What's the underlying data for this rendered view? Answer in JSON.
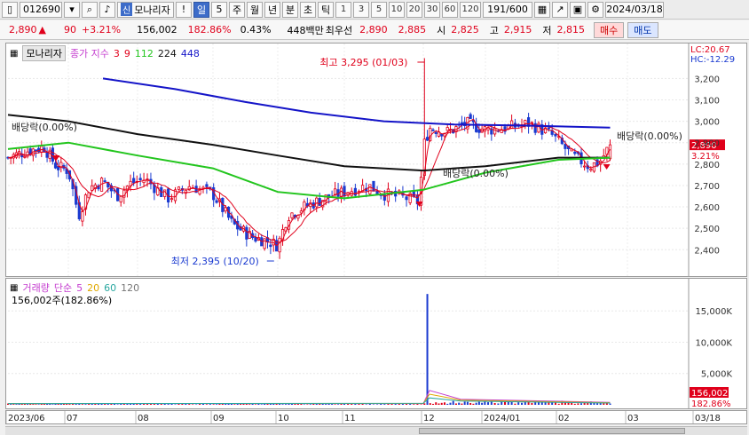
{
  "toolbar": {
    "code": "012690",
    "badge": "신",
    "name": "모나리자",
    "bang": "!",
    "period_day": "일",
    "period_n": "5",
    "period_week": "주",
    "period_month": "월",
    "period_year": "년",
    "period_min": "분",
    "period_sec": "초",
    "period_tick": "틱",
    "intervals": [
      "1",
      "3",
      "5",
      "10",
      "20",
      "30",
      "60",
      "120"
    ],
    "count": "191/600",
    "date": "2024/03/18"
  },
  "quote": {
    "price": "2,890",
    "arrow": "▲",
    "change": "90",
    "change_pct": "+3.21%",
    "volume": "156,002",
    "volume_pct": "182.86%",
    "turnover_pct": "0.43%",
    "amount": "448백만",
    "best_label": "최우선",
    "best_ask": "2,890",
    "best_bid": "2,885",
    "open_label": "시",
    "open": "2,825",
    "high_label": "고",
    "high": "2,915",
    "low_label": "저",
    "low": "2,815",
    "buy": "매수",
    "sell": "매도"
  },
  "colors": {
    "up": "#e0001b",
    "down": "#1a3ad0",
    "ma3": "#e0001b",
    "ma9": "#e0001b",
    "ma112": "#22c51d",
    "ma224": "#111111",
    "ma448": "#1414c8",
    "vol5": "#c43ccf",
    "vol20": "#e0a800",
    "vol60": "#2aa8a0",
    "vol120": "#777777"
  },
  "price_panel": {
    "title": "모나리자",
    "legend_prefix": "종가 지수",
    "ma_periods": [
      "3",
      "9",
      "112",
      "224",
      "448"
    ],
    "lc": "LC:20.67",
    "hc": "HC:-12.29",
    "current_tag": "2,890",
    "current_pct": "3.21%",
    "high_annot": "최고 3,295 (01/03)",
    "low_annot": "최저 2,395 (10/20)",
    "div_annot_1": "배당락(0.00%)",
    "div_annot_2": "배당락(0.00%)",
    "div_annot_3": "배당락(0.00%)"
  },
  "volume_panel": {
    "title": "거래량",
    "legend_prefix": "단순",
    "ma_periods": [
      "5",
      "20",
      "60",
      "120"
    ],
    "current_text": "156,002주(182.86%)",
    "current_tag": "156,002",
    "current_pct": "182.86%"
  },
  "x_axis": {
    "labels": [
      "2023/06",
      "07",
      "08",
      "09",
      "10",
      "11",
      "12",
      "2024/01",
      "02",
      "03",
      "03/18"
    ]
  },
  "chart_data": [
    {
      "type": "candlestick",
      "title": "모나리자",
      "y_ticks": [
        2400,
        2500,
        2600,
        2700,
        2800,
        2900,
        3000,
        3100,
        3200
      ],
      "ylim": [
        2310,
        3330
      ],
      "x_months": [
        "2023/06",
        "07",
        "08",
        "09",
        "10",
        "11",
        "12",
        "2024/01",
        "02",
        "03"
      ],
      "highest": {
        "value": 3295,
        "date": "01/03"
      },
      "lowest": {
        "value": 2395,
        "date": "10/20"
      },
      "last": {
        "open": 2825,
        "high": 2915,
        "low": 2815,
        "close": 2890
      },
      "close_path_anchors": [
        {
          "m": 0.0,
          "close": 2830
        },
        {
          "m": 0.3,
          "close": 2860
        },
        {
          "m": 0.6,
          "close": 2880
        },
        {
          "m": 0.8,
          "close": 2790
        },
        {
          "m": 1.0,
          "close": 2770
        },
        {
          "m": 1.15,
          "close": 2560
        },
        {
          "m": 1.3,
          "close": 2690
        },
        {
          "m": 1.5,
          "close": 2720
        },
        {
          "m": 1.7,
          "close": 2650
        },
        {
          "m": 1.9,
          "close": 2710
        },
        {
          "m": 2.1,
          "close": 2730
        },
        {
          "m": 2.4,
          "close": 2640
        },
        {
          "m": 2.7,
          "close": 2700
        },
        {
          "m": 3.0,
          "close": 2660
        },
        {
          "m": 3.3,
          "close": 2520
        },
        {
          "m": 3.6,
          "close": 2460
        },
        {
          "m": 3.85,
          "close": 2440
        },
        {
          "m": 4.0,
          "close": 2420
        },
        {
          "m": 4.15,
          "close": 2560
        },
        {
          "m": 4.4,
          "close": 2600
        },
        {
          "m": 4.7,
          "close": 2640
        },
        {
          "m": 5.0,
          "close": 2670
        },
        {
          "m": 5.3,
          "close": 2700
        },
        {
          "m": 5.5,
          "close": 2660
        },
        {
          "m": 5.8,
          "close": 2640
        },
        {
          "m": 5.95,
          "close": 2620
        },
        {
          "m": 6.0,
          "close": 2880
        },
        {
          "m": 6.1,
          "close": 2970
        },
        {
          "m": 6.4,
          "close": 2950
        },
        {
          "m": 6.7,
          "close": 2990
        },
        {
          "m": 7.0,
          "close": 2960
        },
        {
          "m": 7.3,
          "close": 2970
        },
        {
          "m": 7.6,
          "close": 2990
        },
        {
          "m": 7.9,
          "close": 2940
        },
        {
          "m": 8.2,
          "close": 2840
        },
        {
          "m": 8.45,
          "close": 2790
        },
        {
          "m": 8.6,
          "close": 2810
        },
        {
          "m": 8.75,
          "close": 2890
        }
      ],
      "ma_series": [
        {
          "name": "224",
          "points": [
            {
              "m": 0,
              "v": 3030
            },
            {
              "m": 1,
              "v": 3000
            },
            {
              "m": 2,
              "v": 2940
            },
            {
              "m": 3,
              "v": 2890
            },
            {
              "m": 4,
              "v": 2840
            },
            {
              "m": 5,
              "v": 2790
            },
            {
              "m": 6,
              "v": 2770
            },
            {
              "m": 7,
              "v": 2790
            },
            {
              "m": 8,
              "v": 2830
            },
            {
              "m": 8.75,
              "v": 2830
            }
          ]
        },
        {
          "name": "112",
          "points": [
            {
              "m": 0,
              "v": 2870
            },
            {
              "m": 1,
              "v": 2900
            },
            {
              "m": 2,
              "v": 2840
            },
            {
              "m": 3,
              "v": 2780
            },
            {
              "m": 4,
              "v": 2670
            },
            {
              "m": 5,
              "v": 2640
            },
            {
              "m": 6,
              "v": 2680
            },
            {
              "m": 7,
              "v": 2760
            },
            {
              "m": 8,
              "v": 2820
            },
            {
              "m": 8.75,
              "v": 2830
            }
          ]
        },
        {
          "name": "448",
          "points": [
            {
              "m": 1.5,
              "v": 3200
            },
            {
              "m": 2.5,
              "v": 3150
            },
            {
              "m": 3.5,
              "v": 3090
            },
            {
              "m": 4.5,
              "v": 3040
            },
            {
              "m": 5.5,
              "v": 3000
            },
            {
              "m": 6.5,
              "v": 2985
            },
            {
              "m": 7.5,
              "v": 2980
            },
            {
              "m": 8.75,
              "v": 2970
            }
          ]
        }
      ]
    },
    {
      "type": "bar",
      "title": "거래량",
      "y_ticks": [
        5000,
        10000,
        15000
      ],
      "y_tick_labels": [
        "5,000K",
        "10,000K",
        "15,000K"
      ],
      "ylim": [
        0,
        19000
      ],
      "spike": {
        "m": 6.05,
        "value_k": 17700
      },
      "last_value": 156002
    }
  ]
}
